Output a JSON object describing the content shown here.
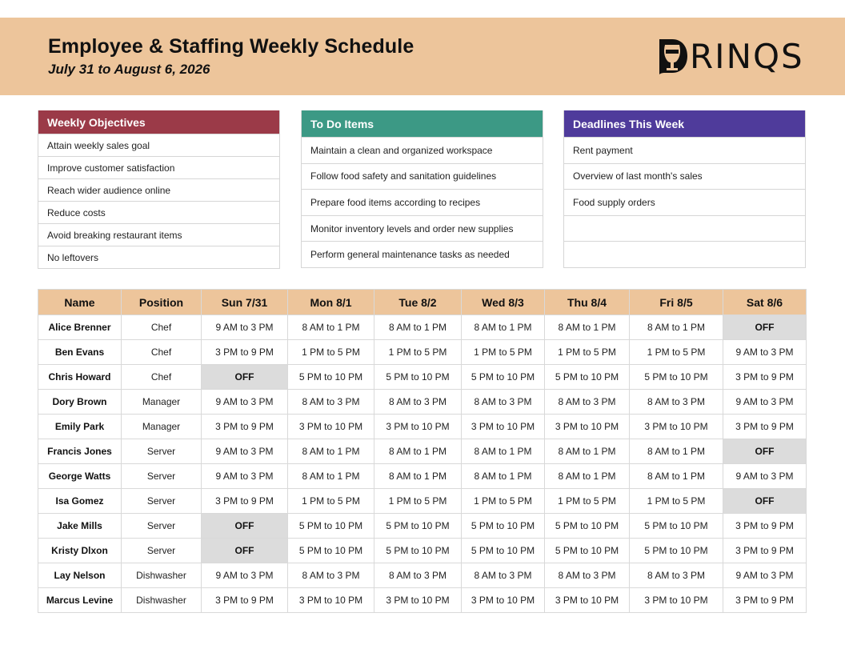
{
  "header": {
    "title": "Employee & Staffing Weekly Schedule",
    "date_range": "July 31 to August 6, 2026",
    "logo_text": "RINQS",
    "logo_icon": "wine-glass-d-icon",
    "background_color": "#edc59b"
  },
  "panels": {
    "objectives": {
      "title": "Weekly Objectives",
      "color": "#9b3a48",
      "items": [
        "Attain weekly sales goal",
        "Improve customer satisfaction",
        "Reach wider audience online",
        "Reduce costs",
        "Avoid breaking restaurant items",
        "No leftovers"
      ]
    },
    "todo": {
      "title": "To Do Items",
      "color": "#3c9985",
      "items": [
        "Maintain a clean and organized workspace",
        "Follow food safety and sanitation guidelines",
        "Prepare food items according to recipes",
        "Monitor inventory levels and order new supplies",
        "Perform general maintenance tasks as needed"
      ]
    },
    "deadlines": {
      "title": "Deadlines This Week",
      "color": "#4f3b9b",
      "items": [
        "Rent payment",
        "Overview of last month's sales",
        "Food supply orders",
        "",
        ""
      ]
    }
  },
  "schedule": {
    "off_label": "OFF",
    "columns": [
      "Name",
      "Position",
      "Sun 7/31",
      "Mon 8/1",
      "Tue 8/2",
      "Wed 8/3",
      "Thu 8/4",
      "Fri 8/5",
      "Sat 8/6"
    ],
    "rows": [
      {
        "name": "Alice Brenner",
        "position": "Chef",
        "shifts": [
          "9 AM to 3 PM",
          "8 AM to 1 PM",
          "8 AM to 1 PM",
          "8 AM to 1 PM",
          "8 AM to 1 PM",
          "8 AM to 1 PM",
          "OFF"
        ]
      },
      {
        "name": "Ben Evans",
        "position": "Chef",
        "shifts": [
          "3 PM to 9 PM",
          "1 PM to 5 PM",
          "1 PM to 5 PM",
          "1 PM to 5 PM",
          "1 PM to 5 PM",
          "1 PM to 5 PM",
          "9 AM to 3 PM"
        ]
      },
      {
        "name": "Chris Howard",
        "position": "Chef",
        "shifts": [
          "OFF",
          "5 PM to 10 PM",
          "5 PM to 10 PM",
          "5 PM to 10 PM",
          "5 PM to 10 PM",
          "5 PM to 10 PM",
          "3 PM to 9 PM"
        ]
      },
      {
        "name": "Dory Brown",
        "position": "Manager",
        "shifts": [
          "9 AM to 3 PM",
          "8 AM to 3 PM",
          "8 AM to 3 PM",
          "8 AM to 3 PM",
          "8 AM to 3 PM",
          "8 AM to 3 PM",
          "9 AM to 3 PM"
        ]
      },
      {
        "name": "Emily Park",
        "position": "Manager",
        "shifts": [
          "3 PM to 9 PM",
          "3 PM to 10 PM",
          "3 PM to 10 PM",
          "3 PM to 10 PM",
          "3 PM to 10 PM",
          "3 PM to 10 PM",
          "3 PM to 9 PM"
        ]
      },
      {
        "name": "Francis Jones",
        "position": "Server",
        "shifts": [
          "9 AM to 3 PM",
          "8 AM to 1 PM",
          "8 AM to 1 PM",
          "8 AM to 1 PM",
          "8 AM to 1 PM",
          "8 AM to 1 PM",
          "OFF"
        ]
      },
      {
        "name": "George Watts",
        "position": "Server",
        "shifts": [
          "9 AM to 3 PM",
          "8 AM to 1 PM",
          "8 AM to 1 PM",
          "8 AM to 1 PM",
          "8 AM to 1 PM",
          "8 AM to 1 PM",
          "9 AM to 3 PM"
        ]
      },
      {
        "name": "Isa Gomez",
        "position": "Server",
        "shifts": [
          "3 PM to 9 PM",
          "1 PM to 5 PM",
          "1 PM to 5 PM",
          "1 PM to 5 PM",
          "1 PM to 5 PM",
          "1 PM to 5 PM",
          "OFF"
        ]
      },
      {
        "name": "Jake Mills",
        "position": "Server",
        "shifts": [
          "OFF",
          "5 PM to 10 PM",
          "5 PM to 10 PM",
          "5 PM to 10 PM",
          "5 PM to 10 PM",
          "5 PM to 10 PM",
          "3 PM to 9 PM"
        ]
      },
      {
        "name": "Kristy Dlxon",
        "position": "Server",
        "shifts": [
          "OFF",
          "5 PM to 10 PM",
          "5 PM to 10 PM",
          "5 PM to 10 PM",
          "5 PM to 10 PM",
          "5 PM to 10 PM",
          "3 PM to 9 PM"
        ]
      },
      {
        "name": "Lay Nelson",
        "position": "Dishwasher",
        "shifts": [
          "9 AM to 3 PM",
          "8 AM to 3 PM",
          "8 AM to 3 PM",
          "8 AM to 3 PM",
          "8 AM to 3 PM",
          "8 AM to 3 PM",
          "9 AM to 3 PM"
        ]
      },
      {
        "name": "Marcus Levine",
        "position": "Dishwasher",
        "shifts": [
          "3 PM to 9 PM",
          "3 PM to 10 PM",
          "3 PM to 10 PM",
          "3 PM to 10 PM",
          "3 PM to 10 PM",
          "3 PM to 10 PM",
          "3 PM to 9 PM"
        ]
      }
    ]
  }
}
